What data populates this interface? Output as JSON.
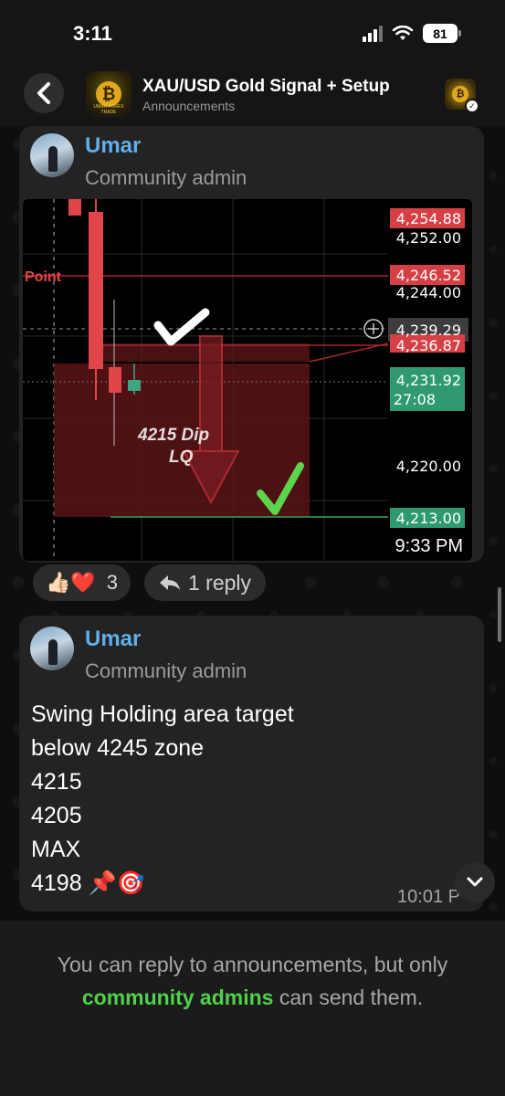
{
  "status_bar": {
    "time": "3:11",
    "battery": "81"
  },
  "header": {
    "title": "XAU/USD Gold Signal + Setup",
    "subtitle": "Announcements",
    "avatar_brand": "UMAR FOREX TRADE"
  },
  "messages": [
    {
      "sender": "Umar",
      "role": "Community admin",
      "image": {
        "price_labels": [
          "4,254.88",
          "4,252.00",
          "4,246.52",
          "4,244.00",
          "4,239.29",
          "4,236.87",
          "4,231.92",
          "27:08",
          "4,220.00",
          "4,213.00"
        ],
        "annotation_point": "Point",
        "annotation_text_1": "4215 Dip",
        "annotation_text_2": "LQ"
      },
      "time": "9:33 PM",
      "reactions": {
        "emojis": "👍🏻❤️",
        "count": "3"
      },
      "reply_label": "1 reply"
    },
    {
      "sender": "Umar",
      "role": "Community admin",
      "lines": [
        "Swing Holding area target",
        "below 4245 zone",
        "4215",
        "4205",
        "MAX",
        "4198 📌🎯"
      ],
      "time": "10:01 P"
    }
  ],
  "footer": {
    "text_before": "You can reply to announcements, but only ",
    "highlight": "community admins",
    "text_after": " can send them."
  },
  "colors": {
    "link_green": "#4fd14a",
    "sender_blue": "#62aee6",
    "candle_red": "#e0454a",
    "candle_green": "#3ea583"
  }
}
